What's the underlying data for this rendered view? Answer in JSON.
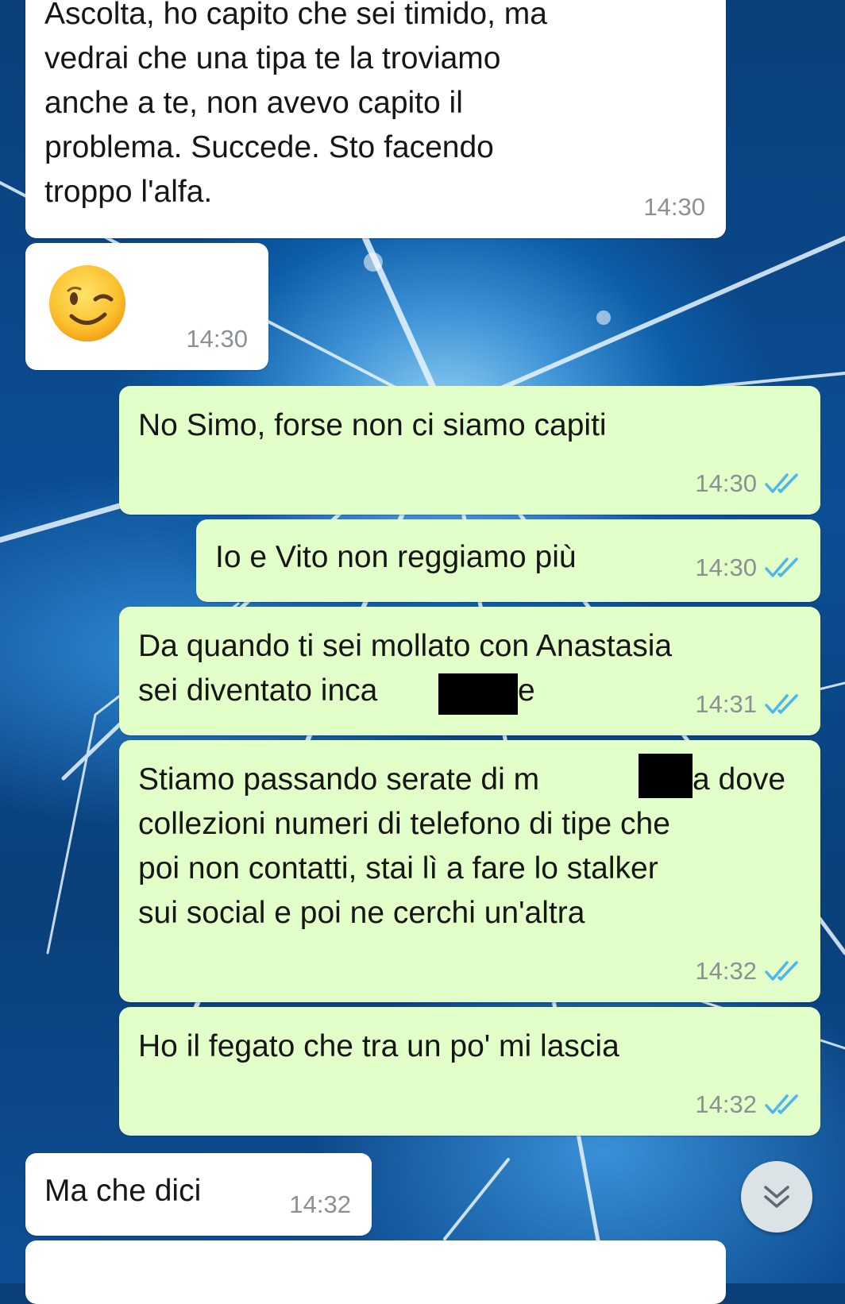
{
  "messages": [
    {
      "id": "m1",
      "direction": "incoming",
      "lines": [
        "Ascolta, ho capito che sei timido, ma",
        "vedrai che una tipa te la troviamo",
        "anche a te, non avevo capito il",
        "problema. Succede. Sto facendo",
        "troppo l'alfa."
      ],
      "time": "14:30"
    },
    {
      "id": "m2",
      "direction": "incoming",
      "emoji": "winking-face",
      "time": "14:30"
    },
    {
      "id": "m3",
      "direction": "outgoing",
      "lines": [
        "No Simo, forse non ci siamo capiti"
      ],
      "time": "14:30",
      "status": "read"
    },
    {
      "id": "m4",
      "direction": "outgoing",
      "lines": [
        "Io e Vito non reggiamo più"
      ],
      "time": "14:30",
      "status": "read"
    },
    {
      "id": "m5",
      "direction": "outgoing",
      "lines": [
        "Da quando ti sei mollato con Anastasia",
        "sei diventato inca",
        "e"
      ],
      "time": "14:31",
      "status": "read"
    },
    {
      "id": "m6",
      "direction": "outgoing",
      "lines": [
        "Stiamo passando serate di m",
        "a dove",
        "collezioni numeri di telefono di tipe che",
        "poi non contatti, stai lì a fare lo stalker",
        "sui social e poi ne cerchi un'altra"
      ],
      "time": "14:32",
      "status": "read"
    },
    {
      "id": "m7",
      "direction": "outgoing",
      "lines": [
        "Ho il fegato che tra un po' mi lascia"
      ],
      "time": "14:32",
      "status": "read"
    },
    {
      "id": "m8",
      "direction": "incoming",
      "lines": [
        "Ma che dici"
      ],
      "time": "14:32"
    }
  ],
  "colors": {
    "incoming_bubble": "#ffffff",
    "outgoing_bubble": "#e3ffc9",
    "read_ticks": "#4fb6ec",
    "timestamp": "#8a9094"
  },
  "icons": {
    "read_receipt": "double-check-icon",
    "scroll_down": "double-chevron-down-icon"
  }
}
